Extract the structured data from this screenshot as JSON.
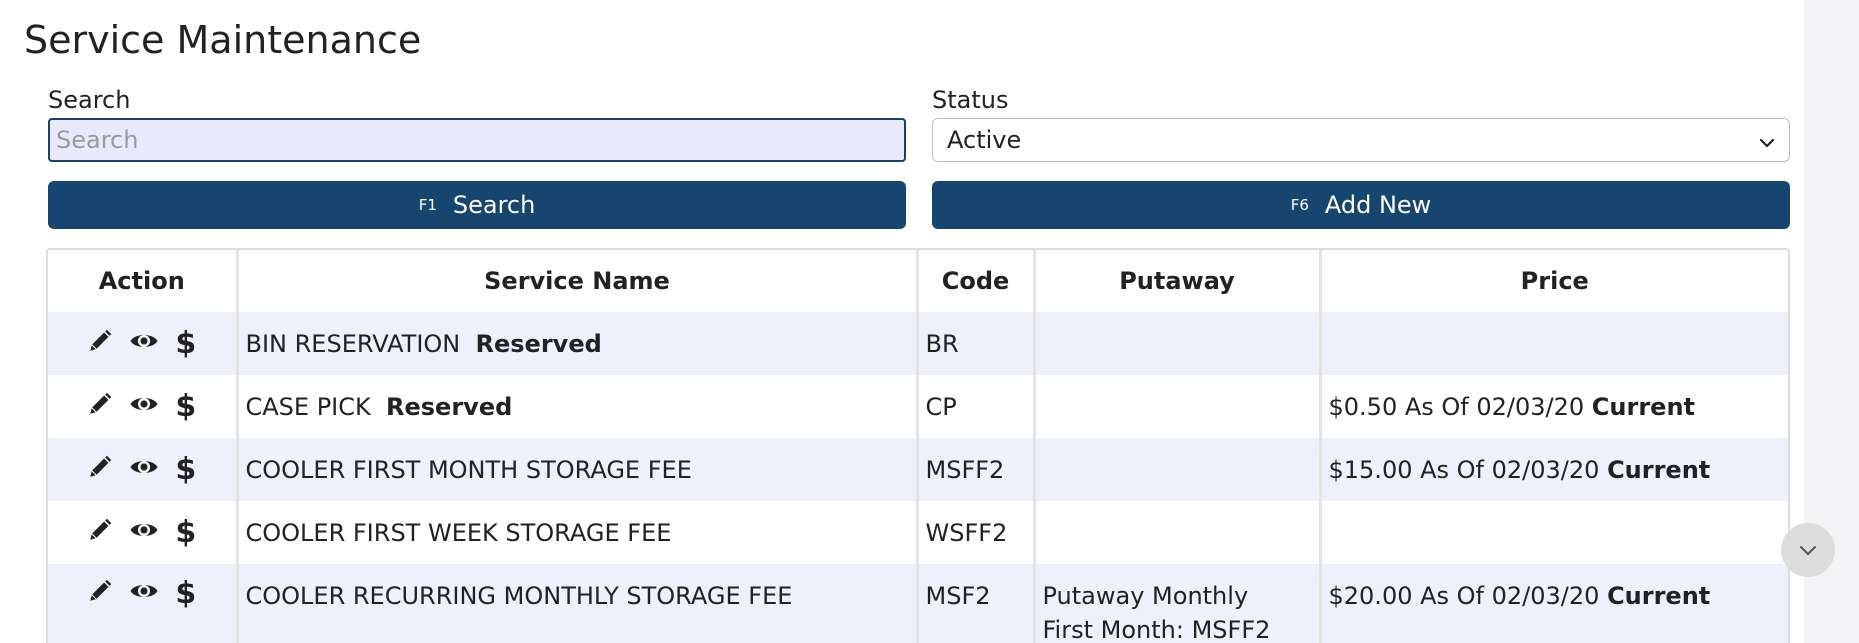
{
  "page": {
    "title": "Service Maintenance"
  },
  "search": {
    "label": "Search",
    "placeholder": "Search",
    "value": ""
  },
  "status": {
    "label": "Status",
    "selected": "Active"
  },
  "buttons": {
    "search": {
      "hotkey": "F1",
      "label": "Search"
    },
    "add_new": {
      "hotkey": "F6",
      "label": "Add New"
    }
  },
  "table": {
    "headers": {
      "action": "Action",
      "service_name": "Service Name",
      "code": "Code",
      "putaway": "Putaway",
      "price": "Price"
    },
    "rows": [
      {
        "name": "BIN RESERVATION",
        "tag": "Reserved",
        "code": "BR",
        "putaway_1": "",
        "putaway_2": "",
        "price": "",
        "price_status": ""
      },
      {
        "name": "CASE PICK",
        "tag": "Reserved",
        "code": "CP",
        "putaway_1": "",
        "putaway_2": "",
        "price": "$0.50 As Of 02/03/20",
        "price_status": "Current"
      },
      {
        "name": "COOLER FIRST MONTH STORAGE FEE",
        "tag": "",
        "code": "MSFF2",
        "putaway_1": "",
        "putaway_2": "",
        "price": "$15.00 As Of 02/03/20",
        "price_status": "Current"
      },
      {
        "name": "COOLER FIRST WEEK STORAGE FEE",
        "tag": "",
        "code": "WSFF2",
        "putaway_1": "",
        "putaway_2": "",
        "price": "",
        "price_status": ""
      },
      {
        "name": "COOLER RECURRING MONTHLY STORAGE FEE",
        "tag": "",
        "code": "MSF2",
        "putaway_1": "Putaway Monthly",
        "putaway_2": "First Month: MSFF2",
        "price": "$20.00 As Of 02/03/20",
        "price_status": "Current"
      }
    ]
  },
  "icons": {
    "edit": "pencil-icon",
    "view": "eye-icon",
    "price": "dollar-icon",
    "scroll": "chevron-down-icon"
  },
  "colors": {
    "primary": "#16466f",
    "row_stripe": "#eef0fc",
    "input_bg": "#e8eafc"
  }
}
